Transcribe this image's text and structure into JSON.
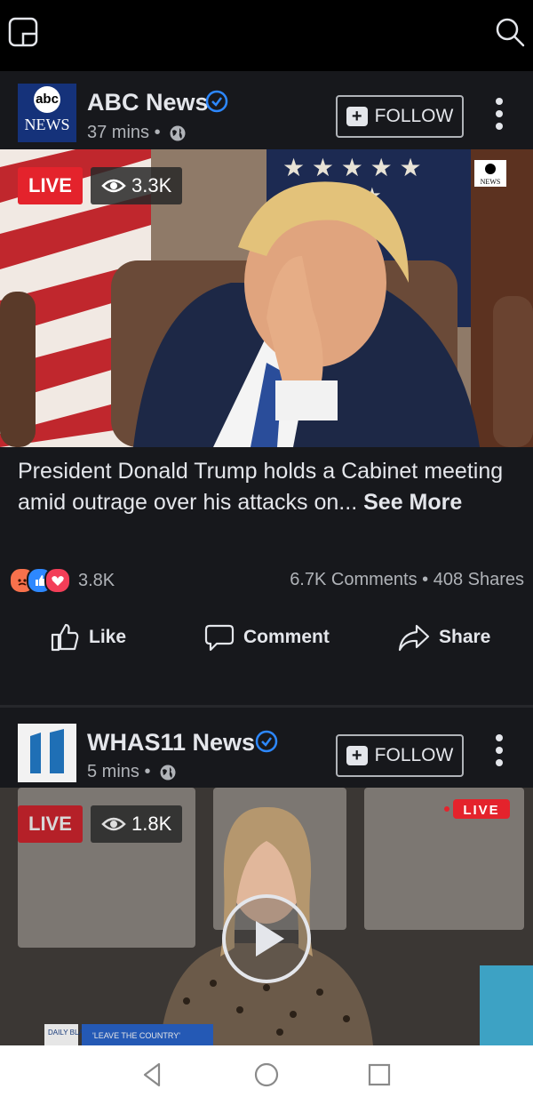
{
  "posts": [
    {
      "page_name": "ABC News",
      "time": "37 mins",
      "follow_label": "FOLLOW",
      "live_label": "LIVE",
      "views": "3.3K",
      "avatar_text_top": "abc",
      "avatar_text_bottom": "NEWS",
      "caption": "President Donald Trump holds a Cabinet meeting amid outrage over his attacks on...",
      "see_more": "See More",
      "reaction_count": "3.8K",
      "comments": "6.7K Comments",
      "shares": "408 Shares",
      "actions": {
        "like": "Like",
        "comment": "Comment",
        "share": "Share"
      },
      "video_logo_top": "abc",
      "video_logo_bottom": "NEWS"
    },
    {
      "page_name": "WHAS11 News",
      "time": "5 mins",
      "follow_label": "FOLLOW",
      "live_label": "LIVE",
      "views": "1.8K",
      "video_live_tag": "LIVE",
      "ticker_left": "DAILY BLAST",
      "ticker_right": "'LEAVE THE COUNTRY'"
    }
  ],
  "colors": {
    "background": "#17181c",
    "accent": "#2d88ff",
    "live_red": "#e4232c",
    "text": "#e4e6eb",
    "secondary_text": "#b0b3b8"
  },
  "icons": [
    "picture-in-picture-icon",
    "search-icon",
    "verified-icon",
    "globe-icon",
    "more-icon",
    "eye-icon",
    "like-icon",
    "comment-icon",
    "share-icon",
    "back-icon",
    "home-icon",
    "recents-icon"
  ]
}
